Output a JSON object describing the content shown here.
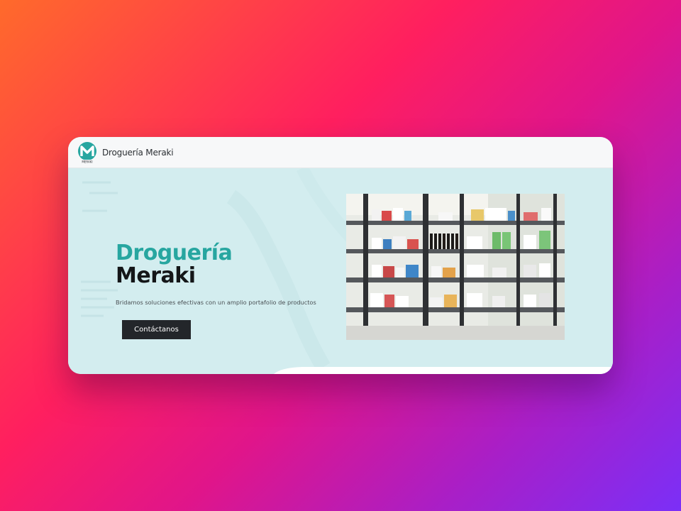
{
  "navbar": {
    "logo_icon": "meraki-logo-icon",
    "logo_caption": "MERAKI",
    "brand_name": "Droguería Meraki"
  },
  "hero": {
    "title_line1": "Droguería",
    "title_line2": "Meraki",
    "subtitle": "Bridamos soluciones efectivas con un amplio portafolio de productos",
    "cta_label": "Contáctanos",
    "photo_icon": "pharmacy-shelves-photo"
  },
  "colors": {
    "accent": "#27a6a0",
    "hero_bg": "#d3edef",
    "button_bg": "#23262a",
    "title_dark": "#141618"
  }
}
